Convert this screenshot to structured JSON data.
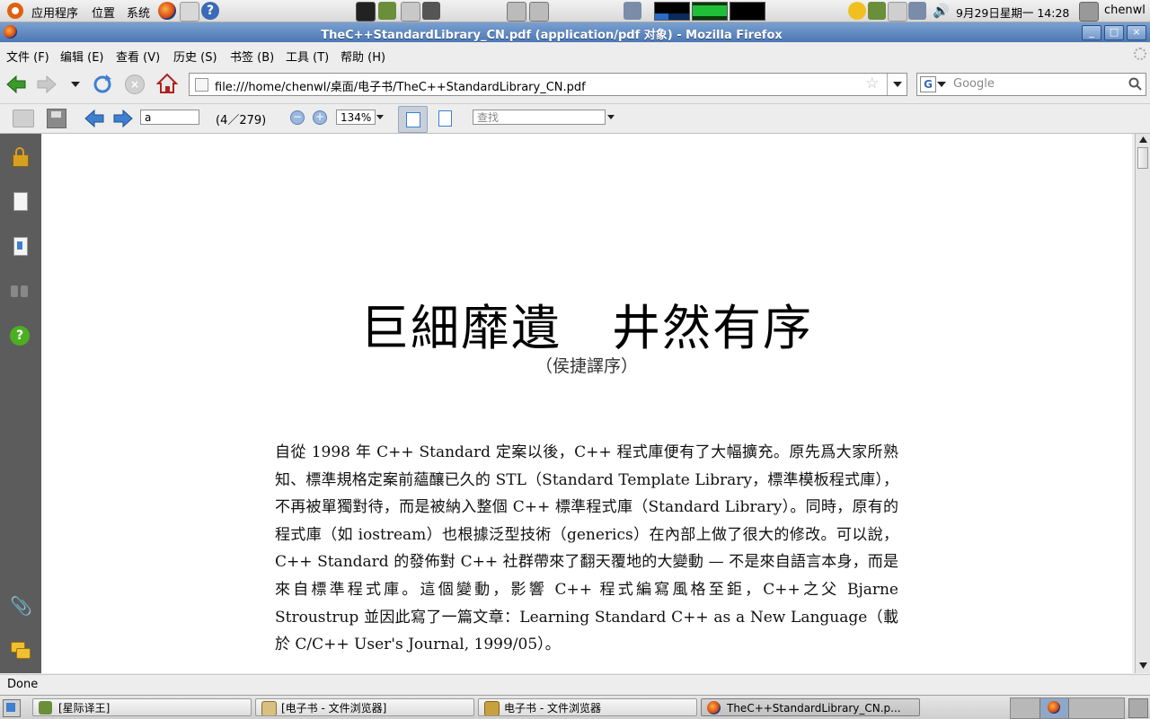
{
  "top_panel": {
    "menus": [
      "应用程序",
      "位置",
      "系统"
    ],
    "clock": "9月29日星期一 14:28",
    "user": "chenwl"
  },
  "window": {
    "title": "TheC++StandardLibrary_CN.pdf (application/pdf 对象) - Mozilla Firefox"
  },
  "menubar": [
    "文件 (F)",
    "编辑 (E)",
    "查看 (V)",
    "历史 (S)",
    "书签 (B)",
    "工具 (T)",
    "帮助 (H)"
  ],
  "navbar": {
    "url": "file:///home/chenwl/桌面/电子书/TheC++StandardLibrary_CN.pdf",
    "search_placeholder": "Google"
  },
  "pdf_toolbar": {
    "page_input": "a",
    "page_count": "(4／279)",
    "zoom": "134%",
    "find_placeholder": "查找"
  },
  "document": {
    "title": "巨細靡遺　井然有序",
    "subtitle": "（侯捷譯序）",
    "paragraph": "自從 1998 年 C++ Standard 定案以後，C++ 程式庫便有了大幅擴充。原先爲大家所熟知、標準規格定案前蘊釀已久的 STL（Standard Template Library，標準模板程式庫），不再被單獨對待，而是被納入整個 C++ 標準程式庫（Standard Library）。同時，原有的程式庫（如 iostream）也根據泛型技術（generics）在內部上做了很大的修改。可以說，C++ Standard 的發佈對 C++ 社群帶來了翻天覆地的大變動 — 不是來自語言本身，而是來自標準程式庫。這個變動，影響 C++ 程式編寫風格至鉅，C++之父 Bjarne Stroustrup 並因此寫了一篇文章：Learning Standard C++ as a New Language（載於 C/C++ User's Journal, 1999/05）。"
  },
  "status": "Done",
  "taskbar": [
    {
      "label": "[星际译王]",
      "active": false
    },
    {
      "label": "[电子书 - 文件浏览器]",
      "active": false
    },
    {
      "label": "电子书 - 文件浏览器",
      "active": false
    },
    {
      "label": "TheC++StandardLibrary_CN.p...",
      "active": true
    }
  ],
  "colors": {
    "titlebar": "#4d78b4",
    "sidebar": "#5c5c5c",
    "accent_green": "#3a9a2a",
    "arrow_blue": "#3f7fcf"
  }
}
